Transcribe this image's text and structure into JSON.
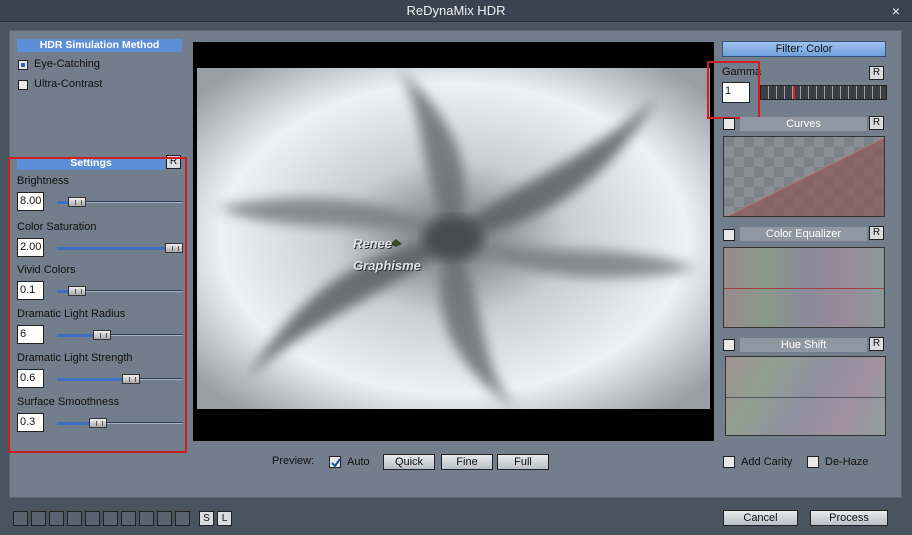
{
  "window": {
    "title": "ReDynaMix HDR",
    "close_glyph": "×"
  },
  "left": {
    "method_header": "HDR Simulation Method",
    "methods": [
      {
        "label": "Eye-Catching",
        "selected": true
      },
      {
        "label": "Ultra-Contrast",
        "selected": false
      }
    ],
    "settings_header": "Settings",
    "reset_label": "R",
    "sliders": [
      {
        "label": "Brightness",
        "value": "8.00",
        "level": 0.1
      },
      {
        "label": "Color Saturation",
        "value": "2.00",
        "level": 1.0
      },
      {
        "label": "Vivid Colors",
        "value": "0.1",
        "level": 0.1
      },
      {
        "label": "Dramatic Light Radius",
        "value": "6",
        "level": 0.33
      },
      {
        "label": "Dramatic Light Strength",
        "value": "0.6",
        "level": 0.6
      },
      {
        "label": "Surface Smoothness",
        "value": "0.3",
        "level": 0.3
      }
    ]
  },
  "preview": {
    "watermark_line1": "Renee",
    "watermark_line2": "Graphisme",
    "label": "Preview:",
    "auto_label": "Auto",
    "auto_checked": true,
    "quick_label": "Quick",
    "fine_label": "Fine",
    "full_label": "Full"
  },
  "right": {
    "filter_header": "Filter: Color",
    "gamma_label": "Gamma",
    "gamma_value": "1",
    "reset_label": "R",
    "curves_label": "Curves",
    "equalizer_label": "Color Equalizer",
    "hue_shift_label": "Hue Shift",
    "add_clarity_label": "Add Carity",
    "dehaze_label": "De-Haze"
  },
  "footer": {
    "s_label": "S",
    "l_label": "L",
    "cancel_label": "Cancel",
    "process_label": "Process"
  },
  "colors": {
    "highlight": "#d01f1f",
    "accent": "#5d8fd6",
    "panel": "#727e8b"
  }
}
